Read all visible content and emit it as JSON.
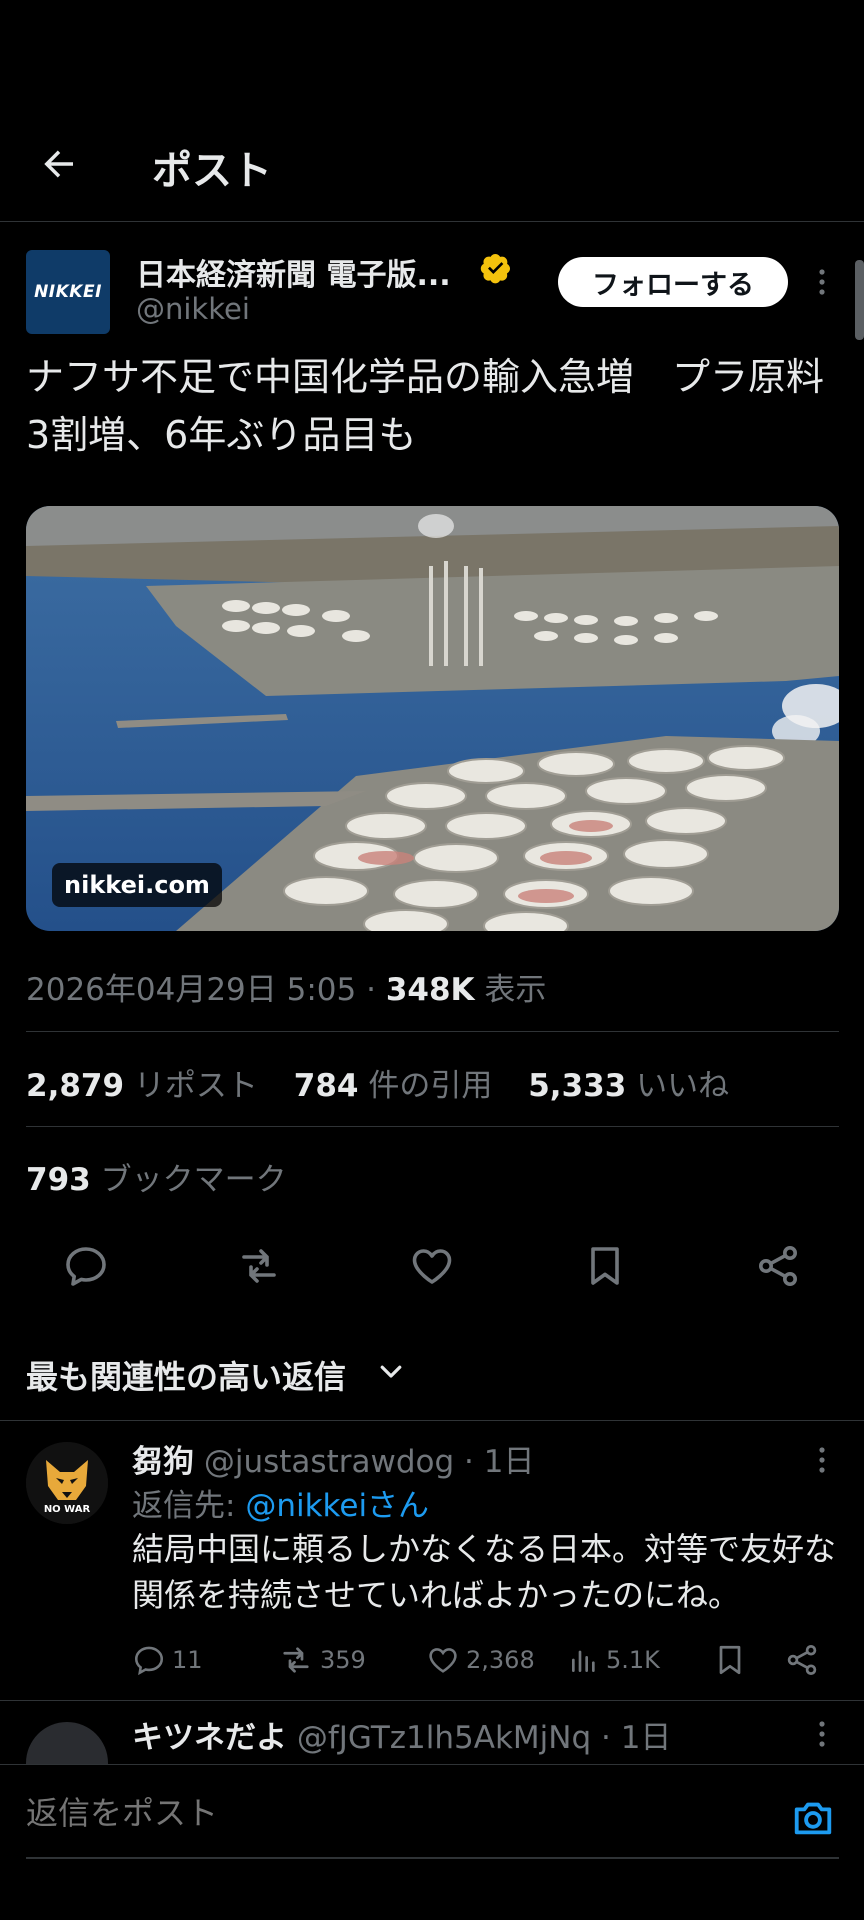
{
  "header": {
    "title": "ポスト",
    "back_icon": "arrow-left-icon"
  },
  "post": {
    "author_name": "日本経済新聞 電子版...",
    "handle": "@nikkei",
    "avatar_text": "NIKKEI",
    "follow_label": "フォローする",
    "text": "ナフサ不足で中国化学品の輸入急増　プラ原料3割増、6年ぶり品目も",
    "media_label": "nikkei.com",
    "timestamp": "2026年04月29日 5:05",
    "views": "348K",
    "views_label": "表示",
    "reposts": "2,879",
    "reposts_label": "リポスト",
    "quotes": "784",
    "quotes_label": "件の引用",
    "likes": "5,333",
    "likes_label": "いいね",
    "bookmarks": "793",
    "bookmarks_label": "ブックマーク"
  },
  "sort_label": "最も関連性の高い返信",
  "reply": {
    "name": "芻狗",
    "handle": "@justastrawdog",
    "time": "1日",
    "reply_to_prefix": "返信先: ",
    "reply_to_link": "@nikkeiさん",
    "text": "結局中国に頼るしかなくなる日本。対等で友好な関係を持続させていればよかったのにね。",
    "avatar_text": "NO WAR",
    "replies": "11",
    "reposts": "359",
    "likes": "2,368",
    "views": "5.1K"
  },
  "reply2": {
    "name": "キツネだよ",
    "handle": "@fJGTz1lh5AkMjNq",
    "time": "1日"
  },
  "composer": {
    "placeholder": "返信をポスト"
  },
  "colors": {
    "accent": "#1d9bf0",
    "verified": "#f4c20d",
    "muted": "#71767b"
  }
}
